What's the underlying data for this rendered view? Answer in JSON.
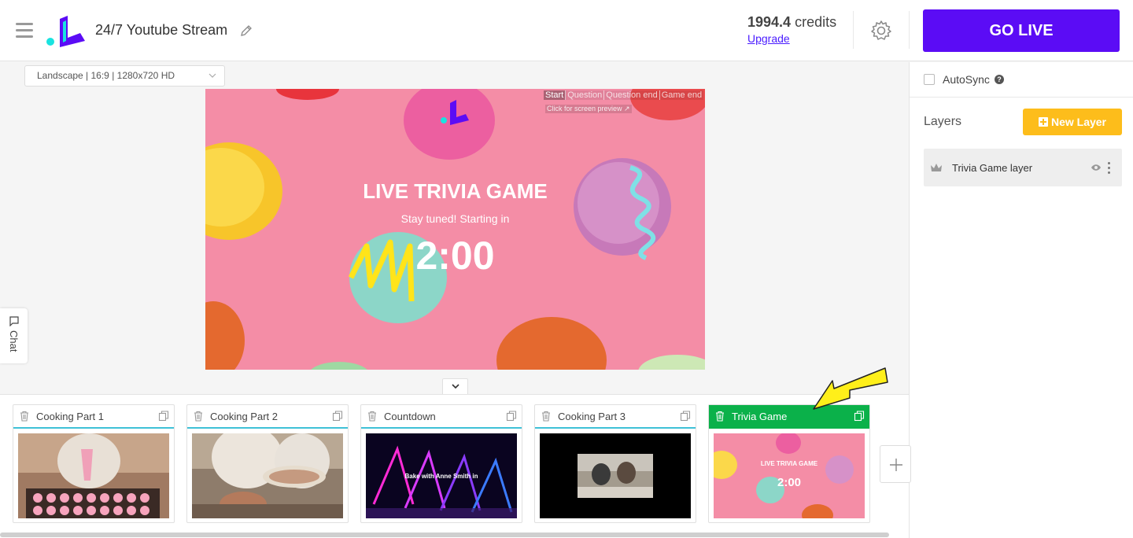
{
  "header": {
    "title": "24/7 Youtube Stream",
    "credits_value": "1994.4",
    "credits_label": "credits",
    "upgrade_label": "Upgrade",
    "go_live_label": "GO LIVE"
  },
  "canvas": {
    "resolution": "Landscape | 16:9 | 1280x720 HD",
    "scene_tabs": [
      "Start",
      "Question",
      "Question end",
      "Game end"
    ],
    "active_scene_tab": "Start",
    "screen_preview_link": "Click for screen preview ↗",
    "overlay": {
      "title": "LIVE TRIVIA GAME",
      "subtitle": "Stay tuned! Starting in",
      "timer": "2:00"
    }
  },
  "chat": {
    "label": "Chat"
  },
  "right_panel": {
    "autosync_label": "AutoSync",
    "layers_title": "Layers",
    "new_layer_label": "New Layer",
    "layers": [
      {
        "name": "Trivia Game layer"
      }
    ]
  },
  "scenes": [
    {
      "name": "Cooking Part 1",
      "active": false
    },
    {
      "name": "Cooking Part 2",
      "active": false
    },
    {
      "name": "Countdown",
      "active": false,
      "thumb_text": "Bake with Anne Smith in"
    },
    {
      "name": "Cooking Part 3",
      "active": false
    },
    {
      "name": "Trivia Game",
      "active": true,
      "thumb_title": "LIVE TRIVIA GAME",
      "thumb_timer": "2:00"
    }
  ],
  "colors": {
    "accent_purple": "#5b0cf5",
    "new_layer_yellow": "#fdbd1b",
    "active_scene_green": "#0bb14a",
    "preview_pink": "#f48da6"
  }
}
